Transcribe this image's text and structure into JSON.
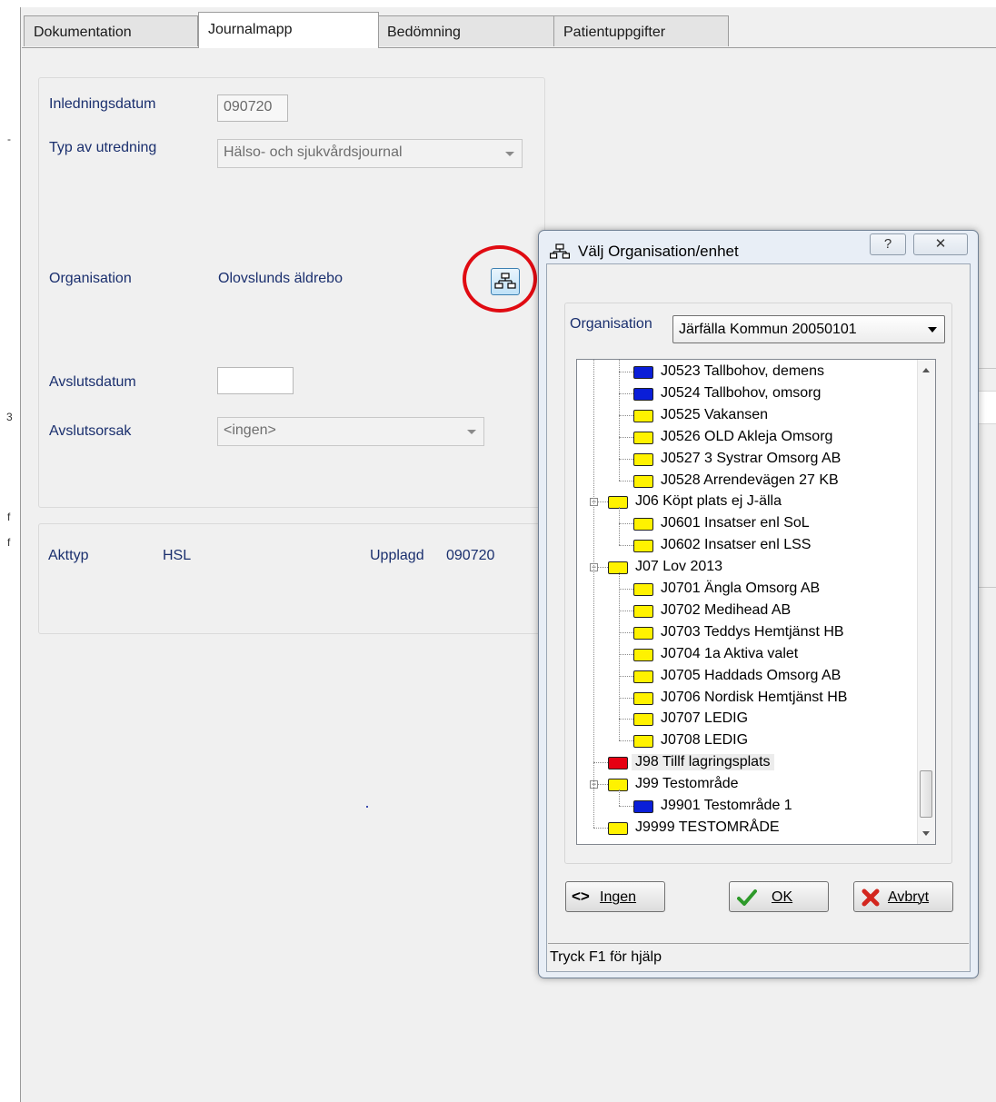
{
  "tabs": [
    {
      "label": "Dokumentation",
      "active": false
    },
    {
      "label": "Journalmapp",
      "active": true
    },
    {
      "label": "Bedömning",
      "active": false
    },
    {
      "label": "Patientuppgifter",
      "active": false
    }
  ],
  "form": {
    "inledningsdatum_label": "Inledningsdatum",
    "inledningsdatum_value": "090720",
    "typ_label": "Typ av utredning",
    "typ_value": "Hälso- och sjukvårdsjournal",
    "organisation_label": "Organisation",
    "organisation_value": "Olovslunds äldrebo",
    "avslutsdatum_label": "Avslutsdatum",
    "avslutsdatum_value": "",
    "avslutsorsak_label": "Avslutsorsak",
    "avslutsorsak_value": "<ingen>"
  },
  "info": {
    "akttyp_label": "Akttyp",
    "akttyp_value": "HSL",
    "upplagd_label": "Upplagd",
    "upplagd_value": "090720"
  },
  "dialog": {
    "title": "Välj Organisation/enhet",
    "help_button": "?",
    "close_button": "✕",
    "org_label": "Organisation",
    "org_value": "Järfälla Kommun 20050101",
    "tree": [
      {
        "text": "J0523  Tallbohov, demens",
        "color": "#0a1ed8",
        "level": 2
      },
      {
        "text": "J0524  Tallbohov, omsorg",
        "color": "#0a1ed8",
        "level": 2
      },
      {
        "text": "J0525  Vakansen",
        "color": "#fff200",
        "level": 2
      },
      {
        "text": "J0526  OLD Akleja Omsorg",
        "color": "#fff200",
        "level": 2
      },
      {
        "text": "J0527  3 Systrar Omsorg AB",
        "color": "#fff200",
        "level": 2
      },
      {
        "text": "J0528  Arrendevägen 27 KB",
        "color": "#fff200",
        "level": 2
      },
      {
        "text": "J06  Köpt plats ej J-älla",
        "color": "#fff200",
        "level": 1,
        "expanded": true
      },
      {
        "text": "J0601  Insatser enl SoL",
        "color": "#fff200",
        "level": 2
      },
      {
        "text": "J0602  Insatser enl LSS",
        "color": "#fff200",
        "level": 2
      },
      {
        "text": "J07  Lov 2013",
        "color": "#fff200",
        "level": 1,
        "expanded": true
      },
      {
        "text": "J0701  Ängla Omsorg AB",
        "color": "#fff200",
        "level": 2
      },
      {
        "text": "J0702  Medihead AB",
        "color": "#fff200",
        "level": 2
      },
      {
        "text": "J0703  Teddys Hemtjänst HB",
        "color": "#fff200",
        "level": 2
      },
      {
        "text": "J0704  1a Aktiva valet",
        "color": "#fff200",
        "level": 2
      },
      {
        "text": "J0705  Haddads Omsorg AB",
        "color": "#fff200",
        "level": 2
      },
      {
        "text": "J0706  Nordisk Hemtjänst HB",
        "color": "#fff200",
        "level": 2
      },
      {
        "text": "J0707  LEDIG",
        "color": "#fff200",
        "level": 2
      },
      {
        "text": "J0708  LEDIG",
        "color": "#fff200",
        "level": 2
      },
      {
        "text": "J98  Tillf lagringsplats",
        "color": "#e60012",
        "level": 1,
        "selected": true
      },
      {
        "text": "J99  Testområde",
        "color": "#fff200",
        "level": 1,
        "expanded": true
      },
      {
        "text": "J9901  Testområde 1",
        "color": "#0a1ed8",
        "level": 2
      },
      {
        "text": "J9999  TESTOMRÅDE",
        "color": "#fff200",
        "level": 1
      }
    ],
    "buttons": {
      "ingen": "Ingen",
      "ok": "OK",
      "avbryt": "Avbryt"
    },
    "status": "Tryck F1 för hjälp"
  }
}
